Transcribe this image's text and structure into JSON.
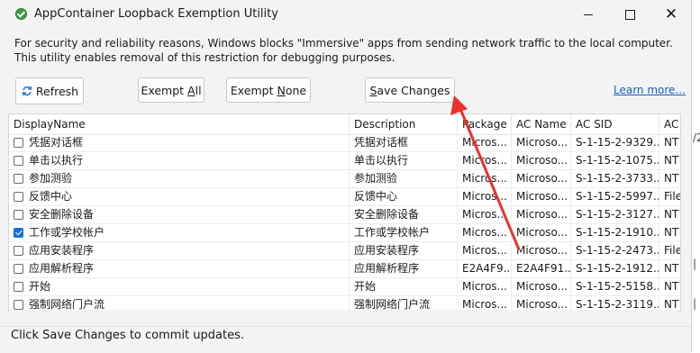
{
  "window": {
    "title": "AppContainer Loopback Exemption Utility",
    "info": "For security and reliability reasons, Windows blocks \"Immersive\" apps from sending network traffic to the local computer. This utility enables removal of this restriction for debugging purposes."
  },
  "toolbar": {
    "refresh": "Refresh",
    "exempt_all_prefix": "Exempt ",
    "exempt_all_key": "A",
    "exempt_all_suffix": "ll",
    "exempt_none_prefix": "Exempt ",
    "exempt_none_key": "N",
    "exempt_none_suffix": "one",
    "save_prefix": "",
    "save_key": "S",
    "save_suffix": "ave Changes",
    "learn_more": "Learn more..."
  },
  "table": {
    "columns": [
      "DisplayName",
      "Description",
      "Package",
      "AC Name",
      "AC SID",
      "AC"
    ],
    "rows": [
      {
        "checked": false,
        "name": "凭据对话框",
        "desc": "凭据对话框",
        "pkg": "Micros...",
        "ac_name": "Microso...",
        "sid": "S-1-15-2-9329...",
        "ac": "NT"
      },
      {
        "checked": false,
        "name": "单击以执行",
        "desc": "单击以执行",
        "pkg": "Micros...",
        "ac_name": "Microso...",
        "sid": "S-1-15-2-1075...",
        "ac": "NT"
      },
      {
        "checked": false,
        "name": "参加测验",
        "desc": "参加测验",
        "pkg": "Micros...",
        "ac_name": "Microso...",
        "sid": "S-1-15-2-3733...",
        "ac": "NT"
      },
      {
        "checked": false,
        "name": "反馈中心",
        "desc": "反馈中心",
        "pkg": "Micros...",
        "ac_name": "Microso...",
        "sid": "S-1-15-2-5997...",
        "ac": "File"
      },
      {
        "checked": false,
        "name": "安全删除设备",
        "desc": "安全删除设备",
        "pkg": "Micros...",
        "ac_name": "Microso...",
        "sid": "S-1-15-2-3127...",
        "ac": "NT"
      },
      {
        "checked": true,
        "name": "工作或学校帐户",
        "desc": "工作或学校帐户",
        "pkg": "Micros...",
        "ac_name": "Microso...",
        "sid": "S-1-15-2-1910...",
        "ac": "NT"
      },
      {
        "checked": false,
        "name": "应用安装程序",
        "desc": "应用安装程序",
        "pkg": "Micros...",
        "ac_name": "Microso...",
        "sid": "S-1-15-2-2473...",
        "ac": "File"
      },
      {
        "checked": false,
        "name": "应用解析程序",
        "desc": "应用解析程序",
        "pkg": "E2A4F9...",
        "ac_name": "E2A4F91...",
        "sid": "S-1-15-2-1912...",
        "ac": "NT"
      },
      {
        "checked": false,
        "name": "开始",
        "desc": "开始",
        "pkg": "Micros...",
        "ac_name": "Microso...",
        "sid": "S-1-15-2-5158...",
        "ac": "NT"
      },
      {
        "checked": false,
        "name": "强制网络门户流",
        "desc": "强制网络门户流",
        "pkg": "Micros...",
        "ac_name": "Microso...",
        "sid": "S-1-15-2-3119...",
        "ac": "NT"
      }
    ]
  },
  "status": "Click Save Changes to commit updates.",
  "behind_window": {
    "chars": [
      "/2",
      "|",
      "|"
    ]
  },
  "colors": {
    "accent": "#1a6fd4",
    "annotation_arrow": "#e8332a",
    "link": "#1a5fb4"
  },
  "icons": {
    "app": "green-check-shield-icon",
    "refresh": "refresh-arrows-icon"
  }
}
